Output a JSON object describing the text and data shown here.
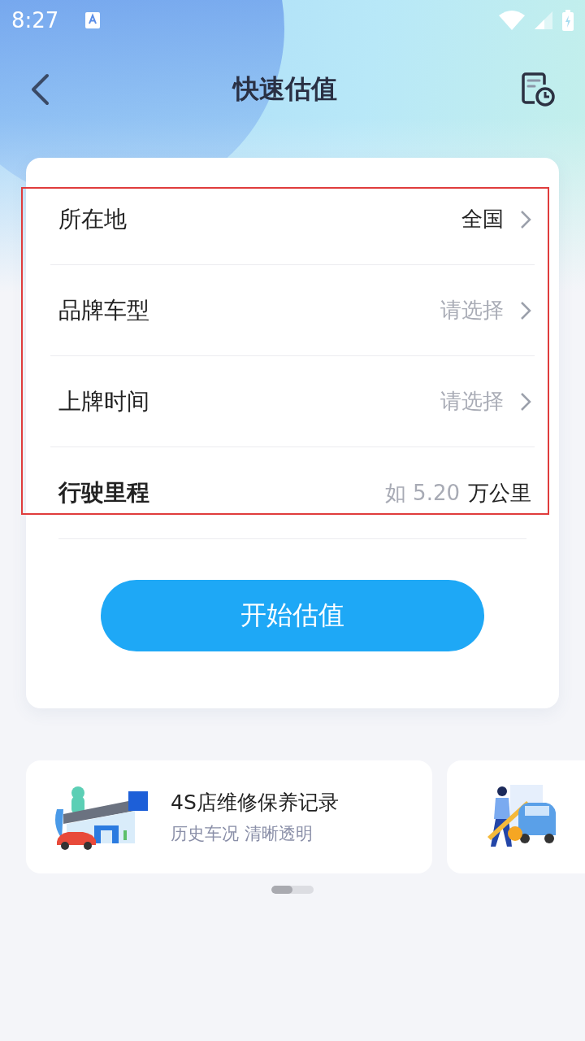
{
  "status_bar": {
    "time": "8:27"
  },
  "header": {
    "title": "快速估值"
  },
  "form": {
    "rows": [
      {
        "kind": "select",
        "label": "所在地",
        "value": "全国"
      },
      {
        "kind": "select",
        "label": "品牌车型",
        "placeholder": "请选择"
      },
      {
        "kind": "select",
        "label": "上牌时间",
        "placeholder": "请选择"
      },
      {
        "kind": "input",
        "label": "行驶里程",
        "placeholder": "如 5.20",
        "unit": "万公里"
      }
    ],
    "submit": "开始估值"
  },
  "banners": [
    {
      "kind": "shop",
      "title": "4S店维修保养记录",
      "subtitle": "历史车况 清晰透明"
    },
    {
      "kind": "person"
    }
  ]
}
